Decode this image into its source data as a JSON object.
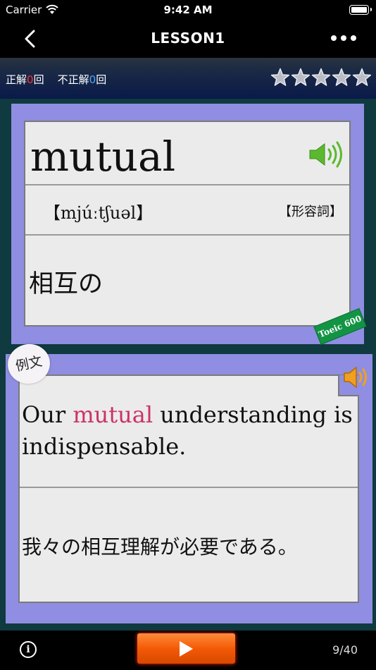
{
  "status": {
    "carrier": "Carrier",
    "time": "9:42 AM"
  },
  "nav": {
    "title": "LESSON1"
  },
  "score": {
    "correct_label": "正解",
    "correct_count": "0",
    "correct_unit": "回",
    "incorrect_label": "不正解",
    "incorrect_count": "0",
    "incorrect_unit": "回",
    "stars_total": 5,
    "stars_filled": 0
  },
  "card": {
    "word": "mutual",
    "pronunciation": "【mjúːtʃuəl】",
    "part_of_speech": "【形容詞】",
    "meaning": "相互の",
    "badge": "Toeic 600"
  },
  "example": {
    "label": "例文",
    "sentence_before": "Our ",
    "sentence_highlight": "mutual",
    "sentence_after": " understanding is indispensable.",
    "translation": "我々の相互理解が必要である。"
  },
  "toolbar": {
    "info": "i",
    "counter": "9/40"
  },
  "colors": {
    "highlight": "#cc3366",
    "frame": "#8f8ee2",
    "play": "#f45a06",
    "badge": "#129444"
  }
}
